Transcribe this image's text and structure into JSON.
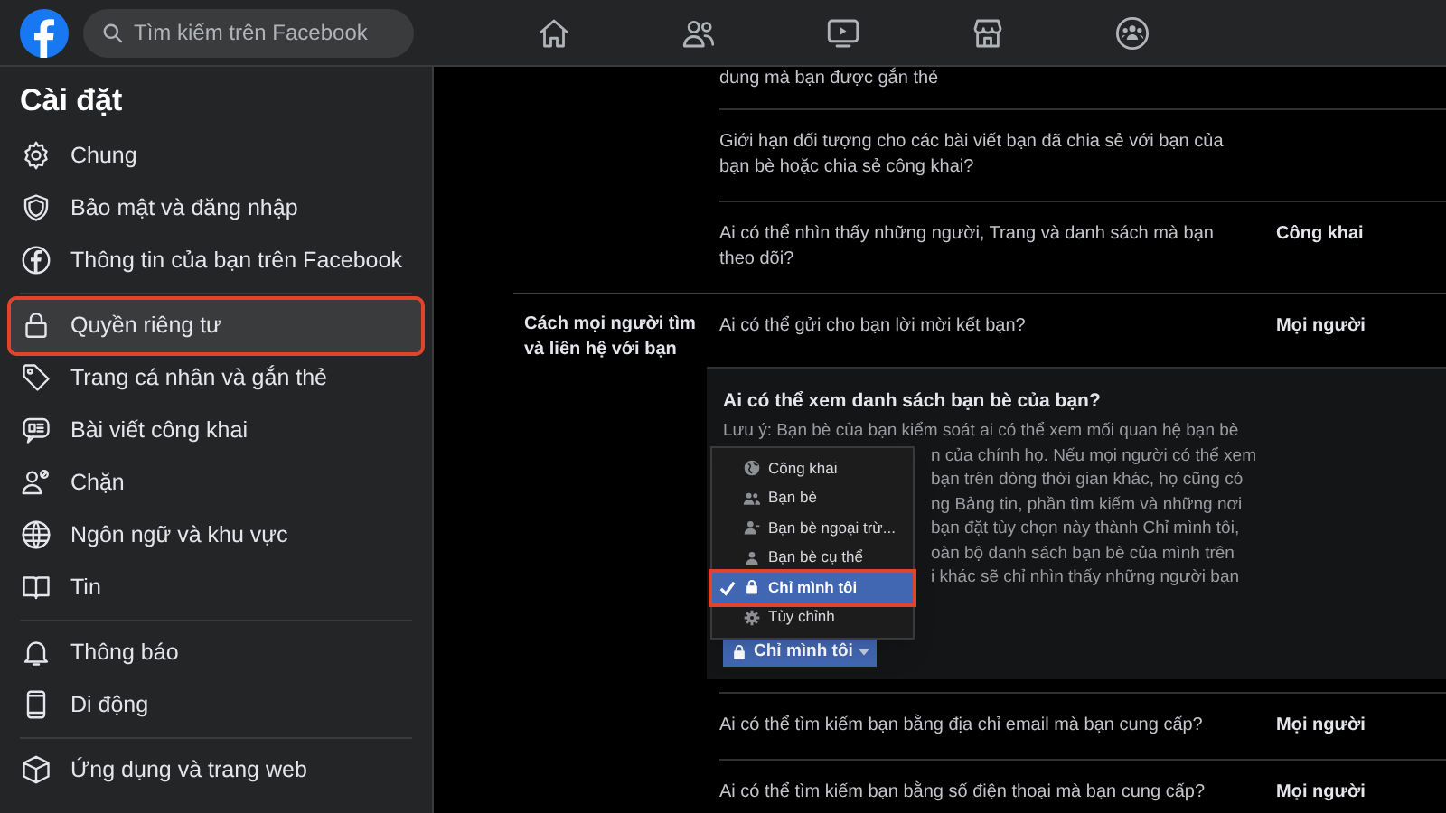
{
  "topbar": {
    "search": {
      "placeholder": "Tìm kiếm trên Facebook"
    },
    "nav": [
      {
        "selected": false
      },
      {
        "selected": false
      },
      {
        "selected": false
      },
      {
        "selected": false
      },
      {
        "selected": false
      }
    ]
  },
  "sidebar": {
    "title": "Cài đặt",
    "groups": [
      [
        {
          "label": "Chung",
          "selected": false
        },
        {
          "label": "Bảo mật và đăng nhập",
          "selected": false
        },
        {
          "label": "Thông tin của bạn trên Facebook",
          "selected": false
        }
      ],
      [
        {
          "label": "Quyền riêng tư",
          "selected": true
        },
        {
          "label": "Trang cá nhân và gắn thẻ",
          "selected": false
        },
        {
          "label": "Bài viết công khai",
          "selected": false
        },
        {
          "label": "Chặn",
          "selected": false
        },
        {
          "label": "Ngôn ngữ và khu vực",
          "selected": false
        },
        {
          "label": "Tin",
          "selected": false
        }
      ],
      [
        {
          "label": "Thông báo",
          "selected": false
        },
        {
          "label": "Di động",
          "selected": false
        }
      ],
      [
        {
          "label": "Ứng dụng và trang web",
          "selected": false
        }
      ]
    ]
  },
  "sections": [
    {
      "rows": [
        {
          "kind": "plain",
          "question": "dung mà bạn được gắn thẻ"
        },
        {
          "kind": "plain",
          "question": "Giới hạn đối tượng cho các bài viết bạn đã chia sẻ với bạn của bạn bè hoặc chia sẻ công khai?"
        },
        {
          "kind": "plain",
          "question": "Ai có thể nhìn thấy những người, Trang và danh sách mà bạn theo dõi?",
          "value": "Công khai"
        }
      ]
    },
    {
      "label": "Cách mọi người tìm và liên hệ với bạn",
      "rows": [
        {
          "kind": "plain",
          "question": "Ai có thể gửi cho bạn lời mời kết bạn?",
          "value": "Mọi người"
        },
        {
          "kind": "expanded",
          "question": "Ai có thể xem danh sách bạn bè của bạn?",
          "note_lines": [
            "Lưu ý: Bạn bè của bạn kiểm soát ai có thể xem mối quan hệ bạn bè",
            "n của chính họ. Nếu mọi người có thể xem",
            "bạn trên dòng thời gian khác, họ cũng có",
            "ng Bảng tin, phần tìm kiếm và những nơi",
            "bạn đặt tùy chọn này thành Chỉ mình tôi,",
            "oàn bộ danh sách bạn bè của mình trên",
            "i khác sẽ chỉ nhìn thấy những người bạn"
          ],
          "menu": [
            {
              "label": "Công khai",
              "selected": false
            },
            {
              "label": "Bạn bè",
              "selected": false
            },
            {
              "label": "Bạn bè ngoại trừ...",
              "selected": false
            },
            {
              "label": "Bạn bè cụ thể",
              "selected": false
            },
            {
              "label": "Chỉ mình tôi",
              "selected": true
            },
            {
              "label": "Tùy chỉnh",
              "selected": false
            }
          ],
          "button": "Chỉ mình tôi"
        },
        {
          "kind": "plain",
          "question": "Ai có thể tìm kiếm bạn bằng địa chỉ email mà bạn cung cấp?",
          "value": "Mọi người"
        },
        {
          "kind": "plain",
          "question": "Ai có thể tìm kiếm bạn bằng số điện thoại mà bạn cung cấp?",
          "value": "Mọi người"
        }
      ]
    }
  ]
}
